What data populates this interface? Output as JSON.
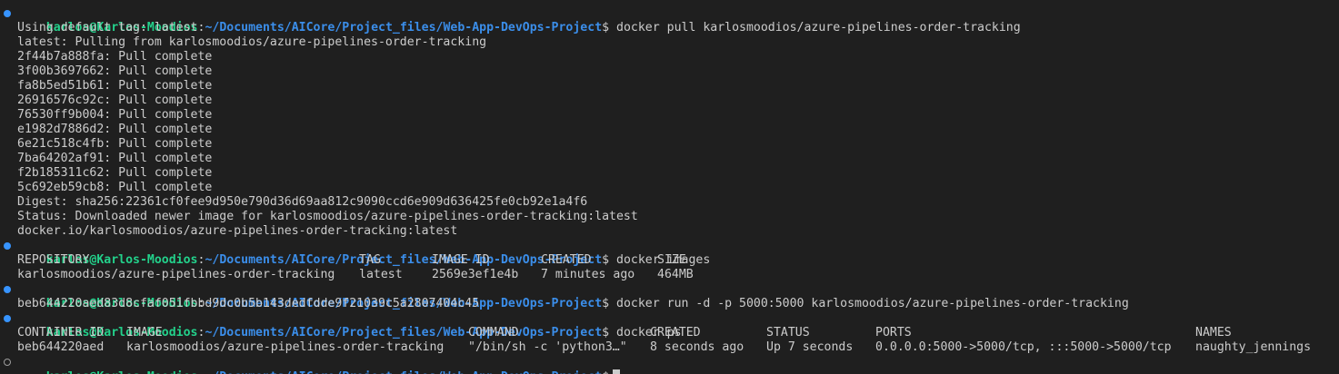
{
  "prompt": {
    "user_host": "karlos@Karlos-Moodios",
    "separator": ":",
    "path": "~/Documents/AICore/Project_files/Web-App-DevOps-Project",
    "symbol": "$"
  },
  "blocks": [
    {
      "command": "docker pull karlosmoodios/azure-pipelines-order-tracking",
      "output": [
        "Using default tag: latest",
        "latest: Pulling from karlosmoodios/azure-pipelines-order-tracking",
        "2f44b7a888fa: Pull complete",
        "3f00b3697662: Pull complete",
        "fa8b5ed51b61: Pull complete",
        "26916576c92c: Pull complete",
        "76530ff9b004: Pull complete",
        "e1982d7886d2: Pull complete",
        "6e21c518c4fb: Pull complete",
        "7ba64202af91: Pull complete",
        "f2b185311c62: Pull complete",
        "5c692eb59cb8: Pull complete",
        "Digest: sha256:22361cf0fee9d950e790d36d69aa812c9090ccd6e909d636425fe0cb92e1a4f6",
        "Status: Downloaded newer image for karlosmoodios/azure-pipelines-order-tracking:latest",
        "docker.io/karlosmoodios/azure-pipelines-order-tracking:latest"
      ]
    },
    {
      "command": "docker images",
      "images_table": {
        "headers": [
          "REPOSITORY",
          "TAG",
          "IMAGE ID",
          "CREATED",
          "SIZE"
        ],
        "rows": [
          [
            "karlosmoodios/azure-pipelines-order-tracking",
            "latest",
            "2569e3ef1e4b",
            "7 minutes ago",
            "464MB"
          ]
        ]
      }
    },
    {
      "command": "docker run -d -p 5000:5000 karlosmoodios/azure-pipelines-order-tracking",
      "output": [
        "beb644220aed83d8cfaf051fbbd9dc0b5b143dedfdde9f21039c5a2807404c45"
      ]
    },
    {
      "command": "docker ps",
      "ps_table": {
        "headers": [
          "CONTAINER ID",
          "IMAGE",
          "COMMAND",
          "CREATED",
          "STATUS",
          "PORTS",
          "NAMES"
        ],
        "rows": [
          [
            "beb644220aed",
            "karlosmoodios/azure-pipelines-order-tracking",
            "\"/bin/sh -c 'python3…\"",
            "8 seconds ago",
            "Up 7 seconds",
            "0.0.0.0:5000->5000/tcp, :::5000->5000/tcp",
            "naughty_jennings"
          ]
        ]
      }
    }
  ],
  "colors": {
    "background": "#1f1f1f",
    "user": "#23d18b",
    "path": "#3b8eea",
    "text": "#cccccc",
    "success_dot": "#3794ff"
  }
}
